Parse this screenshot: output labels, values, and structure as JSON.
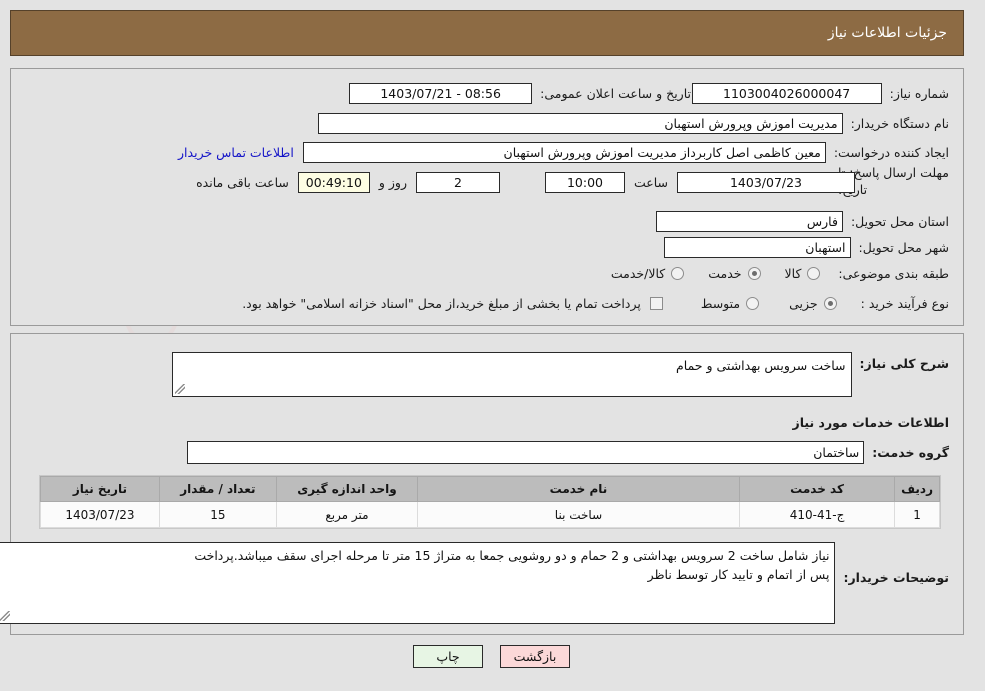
{
  "header": {
    "title": "جزئیات اطلاعات نیاز"
  },
  "watermark": {
    "text": "AnaTender.net"
  },
  "form": {
    "need_number": {
      "label": "شماره نیاز:",
      "value": "1103004026000047"
    },
    "announce_datetime": {
      "label": "تاریخ و ساعت اعلان عمومی:",
      "value": "08:56 - 1403/07/21"
    },
    "buyer_org": {
      "label": "نام دستگاه خریدار:",
      "value": "مدیریت اموزش وپرورش استهبان"
    },
    "creator": {
      "label": "ایجاد کننده درخواست:",
      "value": "معین کاظمی اصل کاربرداز مدیریت اموزش وپرورش استهبان"
    },
    "contact_link": {
      "label": "اطلاعات تماس خریدار"
    },
    "deadline": {
      "label": "مهلت ارسال پاسخ: تا تاریخ:",
      "label_line1": "مهلت ارسال پاسخ: تا",
      "label_line2": "تاریخ:",
      "date": "1403/07/23",
      "hour_label": "ساعت",
      "hour": "10:00",
      "days": "2",
      "days_suffix": "روز و",
      "countdown": "00:49:10",
      "countdown_suffix": "ساعت باقی مانده"
    },
    "province": {
      "label": "استان محل تحویل:",
      "value": "فارس"
    },
    "city": {
      "label": "شهر محل تحویل:",
      "value": "استهبان"
    },
    "category": {
      "label": "طبقه بندی موضوعی:",
      "options": [
        {
          "label": "کالا",
          "selected": false
        },
        {
          "label": "خدمت",
          "selected": true
        },
        {
          "label": "کالا/خدمت",
          "selected": false
        }
      ]
    },
    "process_type": {
      "label": "نوع فرآیند خرید :",
      "options": [
        {
          "label": "جزیی",
          "selected": true
        },
        {
          "label": "متوسط",
          "selected": false
        }
      ]
    },
    "treasury": {
      "checked": false,
      "text": "پرداخت تمام یا بخشی از مبلغ خرید،از محل \"اسناد خزانه اسلامی\" خواهد بود."
    }
  },
  "details": {
    "general_description": {
      "label": "شرح کلی نیاز:",
      "value": "ساخت سرویس بهداشتی و حمام"
    },
    "services_heading": "اطلاعات خدمات مورد نیاز",
    "service_group": {
      "label": "گروه خدمت:",
      "value": "ساختمان"
    },
    "table": {
      "columns": [
        "ردیف",
        "کد خدمت",
        "نام خدمت",
        "واحد اندازه گیری",
        "تعداد / مقدار",
        "تاریخ نیاز"
      ],
      "rows": [
        [
          "1",
          "ج-41-410",
          "ساخت بنا",
          "متر مربع",
          "15",
          "1403/07/23"
        ]
      ]
    },
    "buyer_notes": {
      "label": "توضیحات خریدار:",
      "line1": "نیاز شامل ساخت 2 سرویس بهداشتی و 2 حمام و دو روشویی جمعا به متراژ 15 متر تا مرحله اجرای سقف میباشد.پرداخت",
      "line2": "پس از اتمام و تایید کار توسط ناظر"
    }
  },
  "buttons": {
    "print": "چاپ",
    "back": "بازگشت"
  },
  "colors": {
    "header_bg": "#8d6b44",
    "link": "#1414c8",
    "table_header_bg": "#bcbcbc",
    "btn_print_bg": "#e7f5e4",
    "btn_back_bg": "#fbd8d8",
    "countdown_bg": "#fdfde3"
  }
}
